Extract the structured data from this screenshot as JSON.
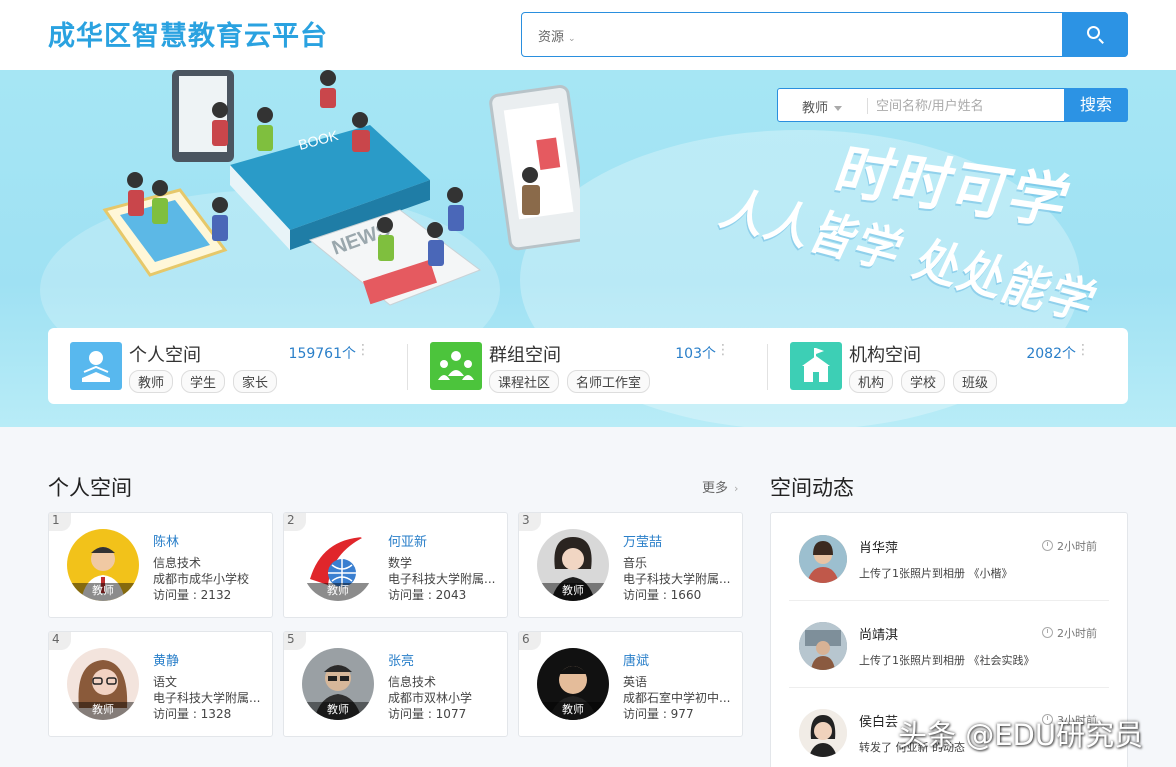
{
  "header": {
    "logo": "成华区智慧教育云平台",
    "search_category": "资源",
    "search_placeholder": ""
  },
  "banner": {
    "slogan_line1": "时时可学",
    "slogan_line2": "人人皆学 处处能学",
    "space_search": {
      "role": "教师",
      "placeholder": "空间名称/用户姓名",
      "button": "搜索"
    },
    "stats": [
      {
        "title": "个人空间",
        "count": "159761个",
        "tags": [
          "教师",
          "学生",
          "家长"
        ],
        "color": "#58b8ee"
      },
      {
        "title": "群组空间",
        "count": "103个",
        "tags": [
          "课程社区",
          "名师工作室"
        ],
        "color": "#4cc43c"
      },
      {
        "title": "机构空间",
        "count": "2082个",
        "tags": [
          "机构",
          "学校",
          "班级"
        ],
        "color": "#3dcfb5"
      }
    ]
  },
  "personal": {
    "title": "个人空间",
    "more": "更多",
    "cards": [
      {
        "rank": "1",
        "name": "陈林",
        "subject": "信息技术",
        "school": "成都市成华小学校",
        "visits": "访问量 : 2132",
        "role": "教师"
      },
      {
        "rank": "2",
        "name": "何亚新",
        "subject": "数学",
        "school": "电子科技大学附属...",
        "visits": "访问量 : 2043",
        "role": "教师"
      },
      {
        "rank": "3",
        "name": "万莹喆",
        "subject": "音乐",
        "school": "电子科技大学附属...",
        "visits": "访问量 : 1660",
        "role": "教师"
      },
      {
        "rank": "4",
        "name": "黄静",
        "subject": "语文",
        "school": "电子科技大学附属...",
        "visits": "访问量 : 1328",
        "role": "教师"
      },
      {
        "rank": "5",
        "name": "张亮",
        "subject": "信息技术",
        "school": "成都市双林小学",
        "visits": "访问量 : 1077",
        "role": "教师"
      },
      {
        "rank": "6",
        "name": "唐斌",
        "subject": "英语",
        "school": "成都石室中学初中...",
        "visits": "访问量 : 977",
        "role": "教师"
      }
    ]
  },
  "activity": {
    "title": "空间动态",
    "items": [
      {
        "name": "肖华萍",
        "time": "2小时前",
        "desc": "上传了1张照片到相册 《小楷》"
      },
      {
        "name": "尚靖淇",
        "time": "2小时前",
        "desc": "上传了1张照片到相册 《社会实践》"
      },
      {
        "name": "侯白芸",
        "time": "3小时前",
        "desc": "转发了 何亚新 的动态"
      }
    ]
  },
  "watermark": "头条 @EDU研究员"
}
